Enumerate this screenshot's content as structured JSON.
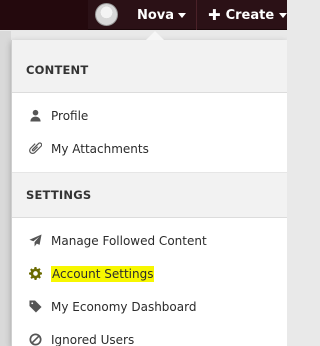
{
  "header": {
    "username": "Nova",
    "create_label": "Create"
  },
  "menu": {
    "sections": [
      {
        "title": "CONTENT",
        "items": [
          {
            "label": "Profile",
            "icon": "user-icon"
          },
          {
            "label": "My Attachments",
            "icon": "paperclip-icon"
          }
        ]
      },
      {
        "title": "SETTINGS",
        "items": [
          {
            "label": "Manage Followed Content",
            "icon": "send-icon"
          },
          {
            "label": "Account Settings",
            "icon": "gear-icon",
            "highlighted": true
          },
          {
            "label": "My Economy Dashboard",
            "icon": "tag-icon"
          },
          {
            "label": "Ignored Users",
            "icon": "ban-icon"
          }
        ]
      }
    ]
  },
  "colors": {
    "topbar": "#2b1116",
    "highlight": "#f7f700"
  }
}
